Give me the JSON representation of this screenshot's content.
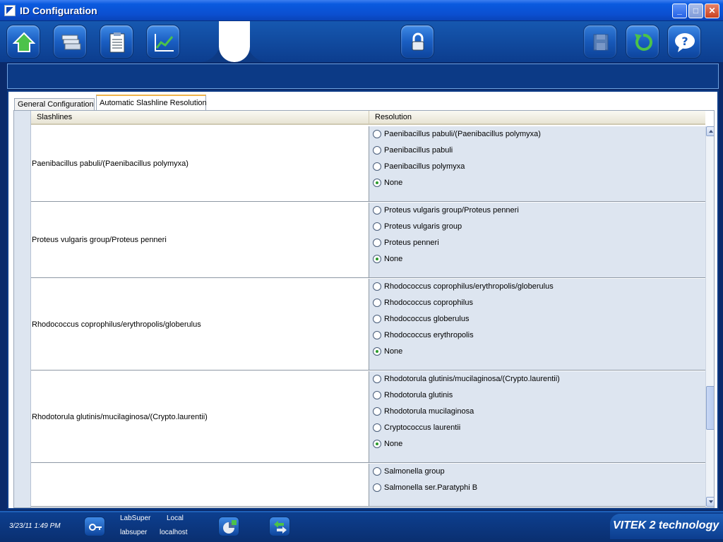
{
  "window": {
    "title": "ID Configuration",
    "min_glyph": "_",
    "max_glyph": "□",
    "close_glyph": "✕"
  },
  "toolbar": {
    "buttons": [
      {
        "name": "home-button",
        "icon": "home-icon"
      },
      {
        "name": "cassette-button",
        "icon": "cassette-icon"
      },
      {
        "name": "reports-button",
        "icon": "clipboard-icon"
      },
      {
        "name": "trend-button",
        "icon": "chart-icon"
      },
      {
        "name": "lock-button",
        "icon": "lock-icon"
      },
      {
        "name": "save-button",
        "icon": "save-icon"
      },
      {
        "name": "undo-button",
        "icon": "undo-icon"
      },
      {
        "name": "help-button",
        "icon": "help-icon"
      }
    ]
  },
  "tabs": {
    "general": "General Configuration",
    "auto": "Automatic Slashline Resolution"
  },
  "table": {
    "headers": {
      "slashlines": "Slashlines",
      "resolution": "Resolution"
    },
    "rows": [
      {
        "name": "Paenibacillus pabuli/(Paenibacillus polymyxa)",
        "options": [
          "Paenibacillus pabuli/(Paenibacillus polymyxa)",
          "Paenibacillus pabuli",
          "Paenibacillus polymyxa",
          "None"
        ],
        "selected": 3
      },
      {
        "name": "Proteus vulgaris group/Proteus penneri",
        "options": [
          "Proteus vulgaris group/Proteus penneri",
          "Proteus vulgaris group",
          "Proteus penneri",
          "None"
        ],
        "selected": 3
      },
      {
        "name": "Rhodococcus coprophilus/erythropolis/globerulus",
        "options": [
          "Rhodococcus coprophilus/erythropolis/globerulus",
          "Rhodococcus coprophilus",
          "Rhodococcus globerulus",
          "Rhodococcus erythropolis",
          "None"
        ],
        "selected": 4
      },
      {
        "name": "Rhodotorula glutinis/mucilaginosa/(Crypto.laurentii)",
        "options": [
          "Rhodotorula glutinis/mucilaginosa/(Crypto.laurentii)",
          "Rhodotorula glutinis",
          "Rhodotorula mucilaginosa",
          "Cryptococcus laurentii",
          "None"
        ],
        "selected": 4
      },
      {
        "name": "",
        "options": [
          "Salmonella group",
          "Salmonella ser.Paratyphi B"
        ],
        "selected": -1
      }
    ]
  },
  "status": {
    "datetime": "3/23/11 1:49 PM",
    "user_role": "LabSuper",
    "user_name": "labsuper",
    "location_type": "Local",
    "location_host": "localhost",
    "brand": "VITEK 2 technology"
  }
}
